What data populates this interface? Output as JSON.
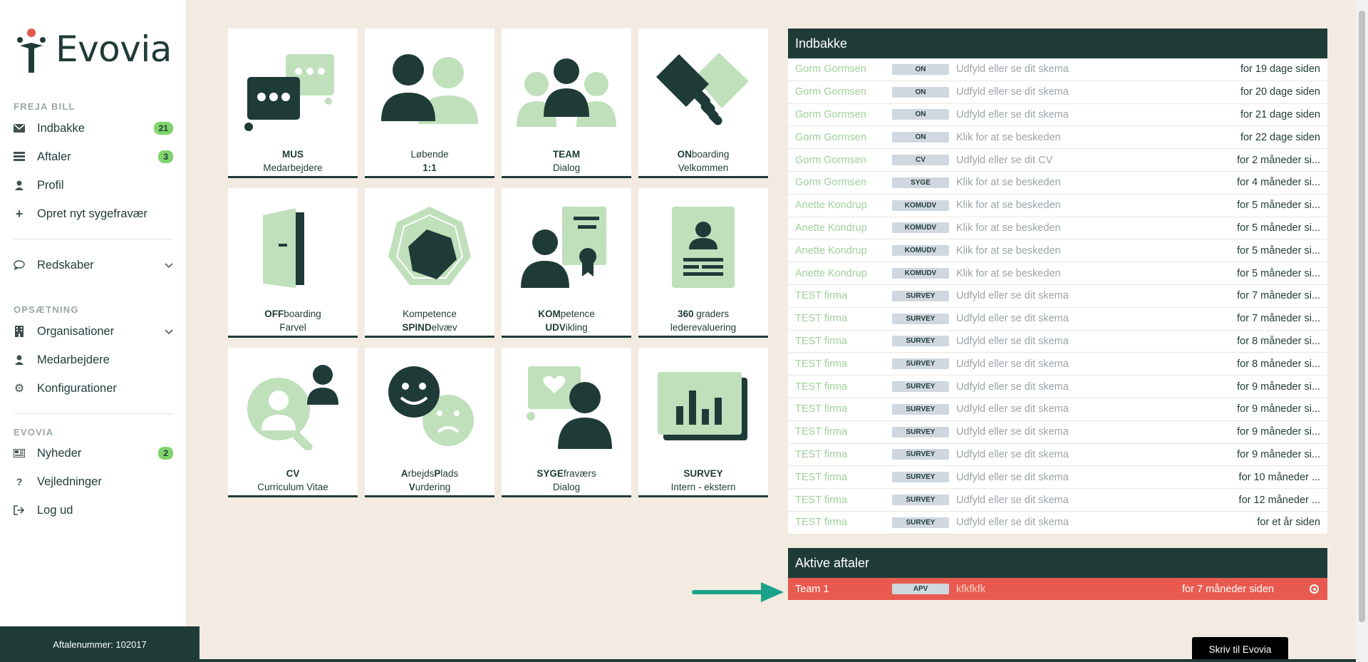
{
  "brand": {
    "name": "Evovia"
  },
  "sidebar": {
    "user_label": "FREJA BILL",
    "items": [
      {
        "label": "Indbakke",
        "badge": "21"
      },
      {
        "label": "Aftaler",
        "badge": "3"
      },
      {
        "label": "Profil"
      },
      {
        "label": "Opret nyt sygefravær"
      }
    ],
    "redskaber": "Redskaber",
    "setup_label": "OPSÆTNING",
    "setup_items": [
      {
        "label": "Organisationer"
      },
      {
        "label": "Medarbejdere"
      },
      {
        "label": "Konfigurationer"
      }
    ],
    "evovia_label": "EVOVIA",
    "evovia_items": [
      {
        "label": "Nyheder",
        "badge": "2"
      },
      {
        "label": "Vejledninger"
      },
      {
        "label": "Log ud"
      }
    ],
    "footer": "Aftalenummer: 102017"
  },
  "tiles": [
    {
      "b1": "MUS",
      "r1": "",
      "l2": "Medarbejdere",
      "b2": ""
    },
    {
      "b1": "",
      "r1": "Løbende",
      "l2": "",
      "b2": "1:1"
    },
    {
      "b1": "TEAM",
      "r1": "",
      "l2": "Dialog",
      "b2": ""
    },
    {
      "b1": "ON",
      "r1": "boarding",
      "l2": "Velkommen",
      "b2": ""
    },
    {
      "b1": "OFF",
      "r1": "boarding",
      "l2": "Farvel",
      "b2": ""
    },
    {
      "b1": "",
      "r1": "Kompetence",
      "l2": "elvæv",
      "b2": "SPIND"
    },
    {
      "b1": "KOM",
      "r1": "petence",
      "l2": "ikling",
      "b2": "UDV"
    },
    {
      "b1": "360",
      "r1": " graders",
      "l2": "lederevaluering",
      "b2": ""
    },
    {
      "b1": "CV",
      "r1": "",
      "l2": "Curriculum Vitae",
      "b2": ""
    },
    {
      "b1": "",
      "r1": "",
      "l2": "",
      "b2": ""
    },
    {
      "b1": "SYGE",
      "r1": "fraværs",
      "l2": "Dialog",
      "b2": ""
    },
    {
      "b1": "SURVEY",
      "r1": "",
      "l2": "Intern - ekstern",
      "b2": ""
    }
  ],
  "tile10": {
    "a1": "A",
    "a2": "rbejds",
    "a3": "P",
    "a4": "lads",
    "v1": "V",
    "v2": "urdering"
  },
  "inbox": {
    "title": "Indbakke",
    "rows": [
      {
        "from": "Gorm Gormsen",
        "tag": "ON",
        "subject": "Udfyld eller se dit skema",
        "time": "for 19 dage siden"
      },
      {
        "from": "Gorm Gormsen",
        "tag": "ON",
        "subject": "Udfyld eller se dit skema",
        "time": "for 20 dage siden"
      },
      {
        "from": "Gorm Gormsen",
        "tag": "ON",
        "subject": "Udfyld eller se dit skema",
        "time": "for 21 dage siden"
      },
      {
        "from": "Gorm Gormsen",
        "tag": "ON",
        "subject": "Klik for at se beskeden",
        "time": "for 22 dage siden"
      },
      {
        "from": "Gorm Gormsen",
        "tag": "CV",
        "subject": "Udfyld eller se dit CV",
        "time": "for 2 måneder si..."
      },
      {
        "from": "Gorm Gormsen",
        "tag": "SYGE",
        "subject": "Klik for at se beskeden",
        "time": "for 4 måneder si..."
      },
      {
        "from": "Anette Kondrup",
        "tag": "KOMUDV",
        "subject": "Klik for at se beskeden",
        "time": "for 5 måneder si..."
      },
      {
        "from": "Anette Kondrup",
        "tag": "KOMUDV",
        "subject": "Klik for at se beskeden",
        "time": "for 5 måneder si..."
      },
      {
        "from": "Anette Kondrup",
        "tag": "KOMUDV",
        "subject": "Klik for at se beskeden",
        "time": "for 5 måneder si..."
      },
      {
        "from": "Anette Kondrup",
        "tag": "KOMUDV",
        "subject": "Klik for at se beskeden",
        "time": "for 5 måneder si..."
      },
      {
        "from": "TEST firma",
        "tag": "SURVEY",
        "subject": "Udfyld eller se dit skema",
        "time": "for 7 måneder si..."
      },
      {
        "from": "TEST firma",
        "tag": "SURVEY",
        "subject": "Udfyld eller se dit skema",
        "time": "for 7 måneder si..."
      },
      {
        "from": "TEST firma",
        "tag": "SURVEY",
        "subject": "Udfyld eller se dit skema",
        "time": "for 8 måneder si..."
      },
      {
        "from": "TEST firma",
        "tag": "SURVEY",
        "subject": "Udfyld eller se dit skema",
        "time": "for 8 måneder si..."
      },
      {
        "from": "TEST firma",
        "tag": "SURVEY",
        "subject": "Udfyld eller se dit skema",
        "time": "for 9 måneder si..."
      },
      {
        "from": "TEST firma",
        "tag": "SURVEY",
        "subject": "Udfyld eller se dit skema",
        "time": "for 9 måneder si..."
      },
      {
        "from": "TEST firma",
        "tag": "SURVEY",
        "subject": "Udfyld eller se dit skema",
        "time": "for 9 måneder si..."
      },
      {
        "from": "TEST firma",
        "tag": "SURVEY",
        "subject": "Udfyld eller se dit skema",
        "time": "for 9 måneder si..."
      },
      {
        "from": "TEST firma",
        "tag": "SURVEY",
        "subject": "Udfyld eller se dit skema",
        "time": "for 10 måneder ..."
      },
      {
        "from": "TEST firma",
        "tag": "SURVEY",
        "subject": "Udfyld eller se dit skema",
        "time": "for 12 måneder ..."
      },
      {
        "from": "TEST firma",
        "tag": "SURVEY",
        "subject": "Udfyld eller se dit skema",
        "time": "for et år siden"
      }
    ]
  },
  "active": {
    "title": "Aktive aftaler",
    "row": {
      "from": "Team 1",
      "tag": "APV",
      "subject": "kfkfkfk",
      "time": "for 7 måneder siden"
    }
  },
  "write_button": "Skriv til Evovia",
  "colors": {
    "dark": "#1f3b38",
    "light_green": "#bfe0bb",
    "badge_green": "#7fd36b",
    "alert_red": "#e85a4f",
    "arrow_teal": "#1ba38a"
  }
}
